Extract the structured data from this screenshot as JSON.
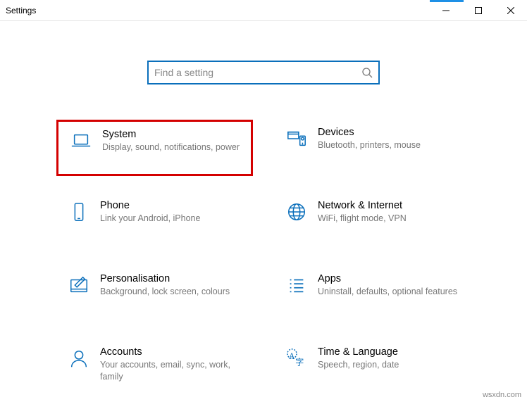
{
  "window": {
    "title": "Settings"
  },
  "search": {
    "placeholder": "Find a setting"
  },
  "tiles": {
    "system": {
      "title": "System",
      "desc": "Display, sound, notifications, power"
    },
    "devices": {
      "title": "Devices",
      "desc": "Bluetooth, printers, mouse"
    },
    "phone": {
      "title": "Phone",
      "desc": "Link your Android, iPhone"
    },
    "network": {
      "title": "Network & Internet",
      "desc": "WiFi, flight mode, VPN"
    },
    "personal": {
      "title": "Personalisation",
      "desc": "Background, lock screen, colours"
    },
    "apps": {
      "title": "Apps",
      "desc": "Uninstall, defaults, optional features"
    },
    "accounts": {
      "title": "Accounts",
      "desc": "Your accounts, email, sync, work, family"
    },
    "timelang": {
      "title": "Time & Language",
      "desc": "Speech, region, date"
    }
  },
  "colors": {
    "accent": "#0a6fbb",
    "highlight": "#d40000"
  },
  "watermark": "wsxdn.com"
}
